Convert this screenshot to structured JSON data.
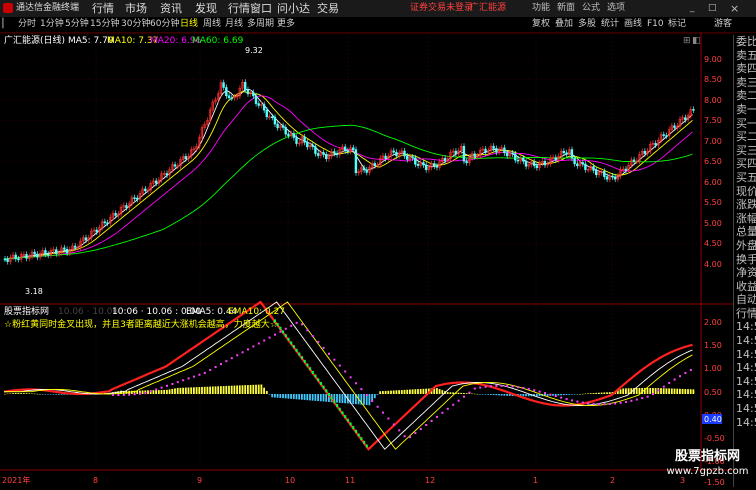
{
  "menubar": {
    "app_title": "通达信金融终端",
    "menus": [
      "行情",
      "市场",
      "资讯",
      "发现",
      "行情窗口",
      "问小达",
      "交易"
    ],
    "login_notice": "证券交易未登录",
    "broker": "广汇能源",
    "right_items": [
      "功能",
      "新面",
      "公式",
      "选项"
    ],
    "window_controls": [
      "_",
      "□",
      "×"
    ]
  },
  "toolbar": {
    "periods": [
      "分时",
      "1分钟",
      "5分钟",
      "15分钟",
      "30分钟",
      "60分钟",
      "日线",
      "周线",
      "月线",
      "多周期",
      "更多"
    ],
    "active_period": "日线",
    "right_buttons": [
      "复权",
      "叠加",
      "多股",
      "统计",
      "画线",
      "F10",
      "标记"
    ],
    "right_extra": "游客"
  },
  "price_panel": {
    "stock_name": "广汇能源(日线)",
    "ma5": "MA5: 7.70",
    "ma10": "MA10: 7.37",
    "ma20": "MA20: 6.96",
    "ma60": "MA60: 6.69",
    "high_label": "9.32",
    "low_label": "3.18",
    "y_ticks": [
      "9.00",
      "8.50",
      "8.00",
      "7.50",
      "7.00",
      "6.50",
      "6.00",
      "5.50",
      "5.00",
      "4.50",
      "4.00"
    ]
  },
  "indicator_panel": {
    "title": "股票指标网",
    "dim_values": "10.06 · 10.06 ·",
    "values": "10:06 · 10.06 : 0.00",
    "ema5": "EMA5: 0.44",
    "ema10": "EMA10: 0.27",
    "note": "☆粉红黄同时金叉出现，并且3者距离越近大涨机会越高，力度越大☆",
    "y_ticks": [
      "2.00",
      "1.50",
      "1.00",
      "0.50",
      "0.00",
      "-0.50",
      "-1.00",
      "-1.50"
    ],
    "current_value": "0.40"
  },
  "x_axis": {
    "labels": [
      "2021年",
      "8",
      "9",
      "10",
      "11",
      "12",
      "1",
      "2",
      "3"
    ]
  },
  "sidebar": {
    "items": [
      "委比",
      "卖五",
      "卖四",
      "卖三",
      "卖二",
      "卖一",
      "买一",
      "买二",
      "买三",
      "买四",
      "买五",
      "现价",
      "涨跌",
      "涨幅",
      "总量",
      "外盘",
      "换手",
      "净资",
      "收益",
      "自动",
      "行情",
      "14:5",
      "14:5",
      "14:5",
      "14:5",
      "14:5",
      "14:5",
      "14:5",
      "14:5"
    ]
  },
  "watermark": {
    "line1": "股票指标网",
    "line2": "www.7gpzb.com"
  },
  "colors": {
    "up": "#ff3232",
    "down": "#54ffff",
    "ma5": "#ffffff",
    "ma10": "#ffff00",
    "ma20": "#ff00ff",
    "ma60": "#00ff00",
    "bar_positive": "#ffff40",
    "bar_negative": "#40c8ff"
  }
}
